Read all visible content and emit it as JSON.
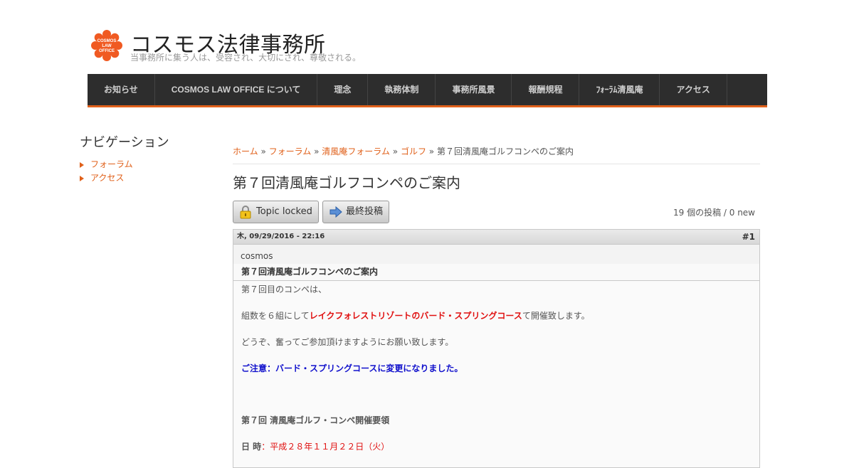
{
  "site": {
    "logo_text": [
      "COSMOS",
      "LAW",
      "OFFICE"
    ],
    "title": "コスモス法律事務所",
    "slogan": "当事務所に集う人は、受容され、大切にされ、尊敬される。"
  },
  "nav": {
    "items": [
      {
        "label": "お知らせ"
      },
      {
        "label": "COSMOS LAW OFFICE について"
      },
      {
        "label": "理念"
      },
      {
        "label": "執務体制"
      },
      {
        "label": "事務所風景"
      },
      {
        "label": "報酬規程"
      },
      {
        "label": "ﾌｫｰﾗﾑ清風庵"
      },
      {
        "label": "アクセス"
      }
    ]
  },
  "sidebar": {
    "heading": "ナビゲーション",
    "items": [
      {
        "label": "フォーラム"
      },
      {
        "label": "アクセス"
      }
    ]
  },
  "breadcrumb": {
    "links": [
      "ホーム",
      "フォーラム",
      "清風庵フォーラム",
      "ゴルフ"
    ],
    "separator": "»",
    "current": "第７回清風庵ゴルフコンペのご案内"
  },
  "topic": {
    "title": "第７回清風庵ゴルフコンペのご案内",
    "locked_label": "Topic locked",
    "last_post_label": "最終投稿",
    "post_count": "19 個の投稿 / 0 new"
  },
  "post": {
    "date": "木, 09/29/2016 - 22:16",
    "number": "#1",
    "author": "cosmos",
    "subject": "第７回清風庵ゴルフコンペのご案内",
    "body": {
      "line1": "第７回目のコンペは、",
      "line2_pre": "組数を６組にして",
      "line2_venue": "レイクフォレストリゾートのバード・スプリングコース",
      "line2_post": "て開催致します。",
      "line3": "どうぞ、奮ってご参加頂けますようにお願い致します。",
      "notice": "ご注意：バード・スプリングコースに変更になりました。",
      "outline_title": "第７回 清風庵ゴルフ・コンペ開催要領",
      "date_label": "日 時",
      "date_sep": "：",
      "date_value": "平成２８年１１月２２日（火）"
    }
  },
  "colors": {
    "accent": "#e0601a",
    "nav_bg": "#2d2d2d",
    "highlight_red": "#e01010",
    "highlight_blue": "#1010cc"
  },
  "icons": {
    "locked": "padlock-icon",
    "last_post": "arrow-right-icon",
    "logo": "cosmos-flower-logo",
    "sidebar_bullet": "triangle-bullet-icon"
  }
}
